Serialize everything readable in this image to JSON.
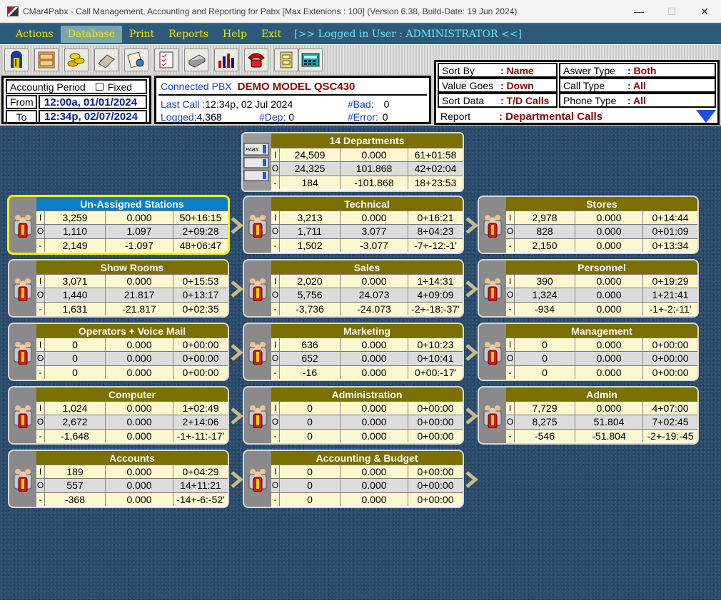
{
  "window": {
    "title": "CMar4Pabx - Call Management, Accounting and Reporting for Pabx [Max Extenions : 100] (Version 6.38, Build-Date: 19 Jun 2024)"
  },
  "menu": {
    "items": [
      "Actions",
      "Database",
      "Print",
      "Reports",
      "Help",
      "Exit"
    ],
    "active": "Database",
    "logged_user": "[>> Logged in User : ADMINISTRATOR <<]"
  },
  "toolbar": {
    "icons": [
      "exit-door-icon",
      "cabinet-icon",
      "coins-icon",
      "phonebook-icon",
      "settings-doc-icon",
      "checklist-icon",
      "printer-icon",
      "chart-icon",
      "telephone-icon",
      "file-cabinet-icon",
      "calculator-icon"
    ]
  },
  "period": {
    "label": "Accountig Period",
    "fixed_label": "Fixed",
    "fixed_checked": false,
    "from_label": "From",
    "from_value": "12:00a, 01/01/2024",
    "to_label": "To",
    "to_value": "12:34p, 02/07/2024"
  },
  "pbx": {
    "connected_label": "Connected PBX",
    "model": "DEMO MODEL QSC430",
    "last_call_label": "Last Call :",
    "last_call": "12:34p, 02 Jul 2024",
    "bad_label": "#Bad:",
    "bad": "0",
    "logged_label": "Logged:",
    "logged": "4,368",
    "dep_label": "#Dep:",
    "dep": "0",
    "error_label": "#Error:",
    "error": "0"
  },
  "sort": {
    "sort_by_label": "Sort By",
    "sort_by": ": Name",
    "value_goes_label": "Value Goes",
    "value_goes": ": Down",
    "sort_data_label": "Sort Data",
    "sort_data": ": T/D Calls",
    "answer_type_label": "Aswer Type",
    "answer_type": ": Both",
    "call_type_label": "Call Type",
    "call_type": ": All",
    "phone_type_label": "Phone Type",
    "phone_type": ": All",
    "report_label": "Report",
    "report": ": Departmental Calls"
  },
  "summary": {
    "title": "14  Departments",
    "rows": [
      [
        "I",
        "24,509",
        "0.000",
        "61+01:58"
      ],
      [
        "O",
        "24,325",
        "101.868",
        "42+02:04"
      ],
      [
        "-",
        "184",
        "-101.868",
        "18+23:53"
      ]
    ]
  },
  "departments": [
    {
      "name": "Un-Assigned Stations",
      "selected": true,
      "rows": [
        [
          "I",
          "3,259",
          "0.000",
          "50+16:15"
        ],
        [
          "O",
          "1,110",
          "1.097",
          "2+09:28"
        ],
        [
          "-",
          "2,149",
          "-1.097",
          "48+06:47"
        ]
      ]
    },
    {
      "name": "Technical",
      "rows": [
        [
          "I",
          "3,213",
          "0.000",
          "0+16:21"
        ],
        [
          "O",
          "1,711",
          "3.077",
          "8+04:23"
        ],
        [
          "-",
          "1,502",
          "-3.077",
          "-7+-12:-1'"
        ]
      ]
    },
    {
      "name": "Stores",
      "rows": [
        [
          "I",
          "2,978",
          "0.000",
          "0+14:44"
        ],
        [
          "O",
          "828",
          "0.000",
          "0+01:09"
        ],
        [
          "-",
          "2,150",
          "0.000",
          "0+13:34"
        ]
      ]
    },
    {
      "name": "Show Rooms",
      "rows": [
        [
          "I",
          "3,071",
          "0.000",
          "0+15:53"
        ],
        [
          "O",
          "1,440",
          "21.817",
          "0+13:17"
        ],
        [
          "-",
          "1,631",
          "-21.817",
          "0+02:35"
        ]
      ]
    },
    {
      "name": "Sales",
      "rows": [
        [
          "I",
          "2,020",
          "0.000",
          "1+14:31"
        ],
        [
          "O",
          "5,756",
          "24.073",
          "4+09:09"
        ],
        [
          "-",
          "-3,736",
          "-24.073",
          "-2+-18:-37'"
        ]
      ]
    },
    {
      "name": "Personnel",
      "rows": [
        [
          "I",
          "390",
          "0.000",
          "0+19:29"
        ],
        [
          "O",
          "1,324",
          "0.000",
          "1+21:41"
        ],
        [
          "-",
          "-934",
          "0.000",
          "-1+-2:-11'"
        ]
      ]
    },
    {
      "name": "Operators + Voice Mail",
      "rows": [
        [
          "I",
          "0",
          "0.000",
          "0+00:00"
        ],
        [
          "O",
          "0",
          "0.000",
          "0+00:00"
        ],
        [
          "-",
          "0",
          "0.000",
          "0+00:00"
        ]
      ]
    },
    {
      "name": "Marketing",
      "rows": [
        [
          "I",
          "636",
          "0.000",
          "0+10:23"
        ],
        [
          "O",
          "652",
          "0.000",
          "0+10:41"
        ],
        [
          "-",
          "-16",
          "0.000",
          "0+00:-17'"
        ]
      ]
    },
    {
      "name": "Management",
      "rows": [
        [
          "I",
          "0",
          "0.000",
          "0+00:00"
        ],
        [
          "O",
          "0",
          "0.000",
          "0+00:00"
        ],
        [
          "-",
          "0",
          "0.000",
          "0+00:00"
        ]
      ]
    },
    {
      "name": "Computer",
      "rows": [
        [
          "I",
          "1,024",
          "0.000",
          "1+02:49"
        ],
        [
          "O",
          "2,672",
          "0.000",
          "2+14:06"
        ],
        [
          "-",
          "-1,648",
          "0.000",
          "-1+-11:-17'"
        ]
      ]
    },
    {
      "name": "Administration",
      "rows": [
        [
          "I",
          "0",
          "0.000",
          "0+00:00"
        ],
        [
          "O",
          "0",
          "0.000",
          "0+00:00"
        ],
        [
          "-",
          "0",
          "0.000",
          "0+00:00"
        ]
      ]
    },
    {
      "name": "Admin",
      "rows": [
        [
          "I",
          "7,729",
          "0.000",
          "4+07:00"
        ],
        [
          "O",
          "8,275",
          "51.804",
          "7+02:45"
        ],
        [
          "-",
          "-546",
          "-51.804",
          "-2+-19:-45"
        ]
      ]
    },
    {
      "name": "Accounts",
      "rows": [
        [
          "I",
          "189",
          "0.000",
          "0+04:29"
        ],
        [
          "O",
          "557",
          "0.000",
          "14+11:21"
        ],
        [
          "-",
          "-368",
          "0.000",
          "-14+-6:-52'"
        ]
      ]
    },
    {
      "name": "Accounting & Budget",
      "rows": [
        [
          "I",
          "0",
          "0.000",
          "0+00:00"
        ],
        [
          "O",
          "0",
          "0.000",
          "0+00:00"
        ],
        [
          "-",
          "0",
          "0.000",
          "0+00:00"
        ]
      ]
    }
  ],
  "colors": {
    "menu_bg": "#2c5a7a",
    "menu_text": "#f4e600",
    "header_olive": "#7b6f00",
    "selected_header": "#0b7ec7",
    "selected_border": "#f7f000",
    "desk": "#2a4a68"
  }
}
